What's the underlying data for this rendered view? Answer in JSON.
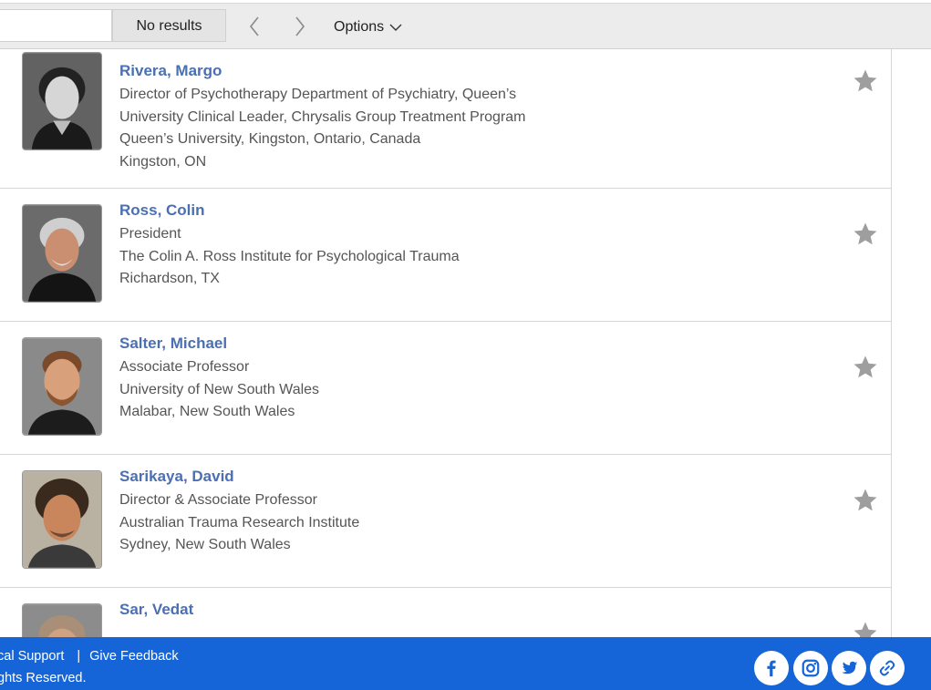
{
  "findbar": {
    "input_value": "",
    "status": "No results",
    "options_label": "Options"
  },
  "people": [
    {
      "name": "Rivera, Margo",
      "lines": [
        "Director of Psychotherapy Department of Psychiatry, Queen’s",
        "University Clinical Leader, Chrysalis Group Treatment Program",
        "Queen’s University, Kingston, Ontario, Canada",
        "Kingston, ON"
      ]
    },
    {
      "name": "Ross, Colin",
      "lines": [
        "President",
        "The Colin A. Ross Institute for Psychological Trauma",
        "Richardson, TX"
      ]
    },
    {
      "name": "Salter, Michael",
      "lines": [
        "Associate Professor",
        "University of New South Wales",
        "Malabar, New South Wales"
      ]
    },
    {
      "name": "Sarikaya, David",
      "lines": [
        "Director & Associate Professor",
        "Australian Trauma Research Institute",
        "Sydney, New South Wales"
      ]
    },
    {
      "name": "Sar, Vedat",
      "lines": []
    }
  ],
  "footer": {
    "support_link": "cal Support",
    "separator": "|",
    "feedback_link": "Give Feedback",
    "copyright": "ghts Reserved."
  },
  "social_icons": [
    "facebook-icon",
    "instagram-icon",
    "twitter-icon",
    "link-icon"
  ],
  "colors": {
    "name_link": "#4a6fb3",
    "footer_bg": "#1565d8",
    "star": "#9e9e9e"
  }
}
